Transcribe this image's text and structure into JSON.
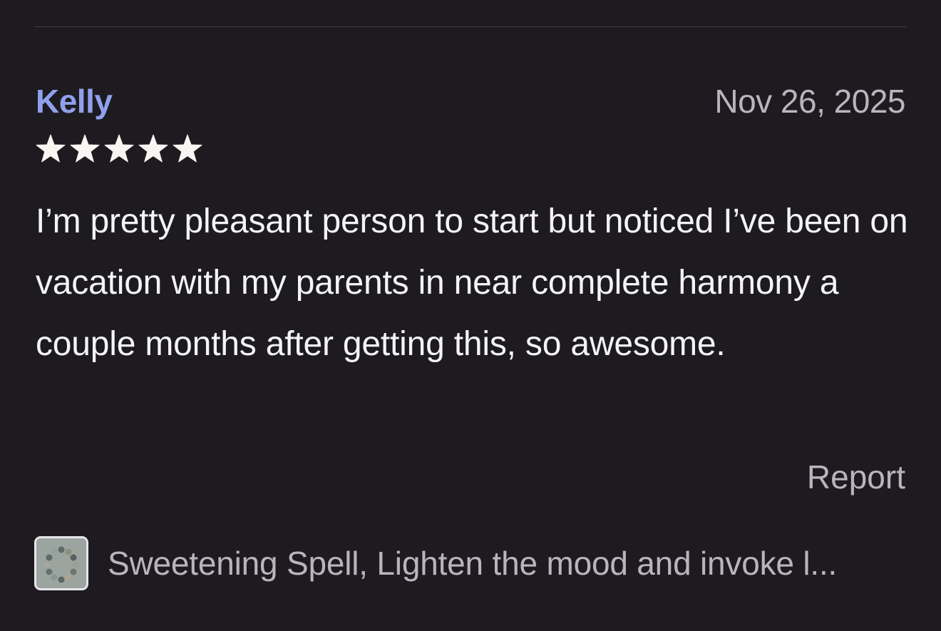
{
  "review": {
    "reviewer_name": "Kelly",
    "date": "Nov 26, 2025",
    "rating": 5,
    "rating_max": 5,
    "text": "I’m pretty pleasant person to start but noticed I’ve been on vacation with my parents in near complete harmony a couple months after getting this, so awesome.",
    "report_label": "Report"
  },
  "product": {
    "title": "Sweetening Spell, Lighten the mood and invoke l...",
    "thumbnail_icon": "bead-bracelet-thumbnail"
  },
  "colors": {
    "background": "#1d1b1f",
    "reviewer_name": "#8fa0ec",
    "body_text": "#f4f3f6",
    "muted_text": "#b9b5bf",
    "star": "#f7f6f2"
  }
}
